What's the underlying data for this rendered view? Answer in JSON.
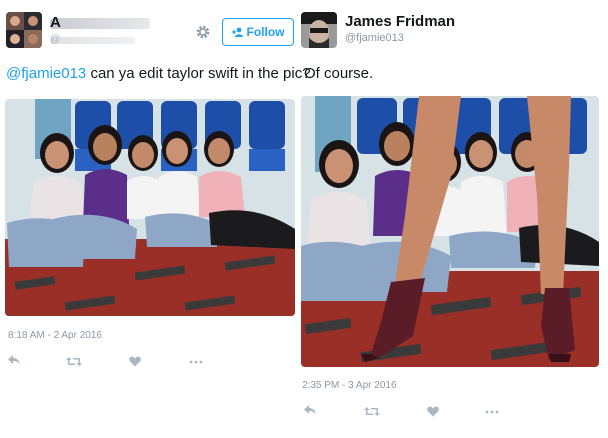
{
  "left_tweet": {
    "name_initial": "A",
    "handle_initial": "@",
    "follow_label": "Follow",
    "mention": "@fjamie013",
    "text": " can ya edit taylor swift in the pic?",
    "timestamp": "8:18 AM - 2 Apr 2016"
  },
  "right_tweet": {
    "name": "James Fridman",
    "handle": "@fjamie013",
    "text": "Of course.",
    "timestamp": "2:35 PM - 3 Apr 2016"
  },
  "icons": {
    "gear": "gear-icon",
    "reply": "reply-icon",
    "retweet": "retweet-icon",
    "like": "heart-icon",
    "more": "more-icon"
  },
  "colors": {
    "accent": "#1da1f2",
    "muted": "#aab8c2",
    "text": "#14171a",
    "timestamp": "#8899a6"
  }
}
